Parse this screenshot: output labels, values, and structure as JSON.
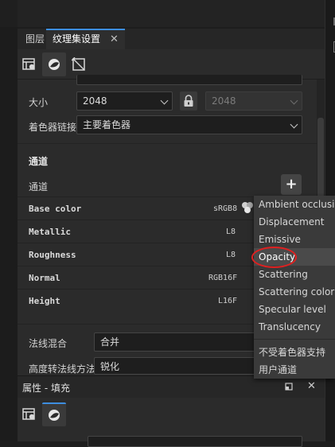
{
  "tabs": [
    {
      "label": "图层"
    },
    {
      "label": "纹理集设置",
      "close": "✕"
    }
  ],
  "settings": {
    "size_label": "大小",
    "size_value": "2048",
    "size_linked_value": "2048",
    "shader_link_label": "着色器链接",
    "shader_link_value": "主要着色器"
  },
  "channels": {
    "section_title": "通道",
    "channel_label": "通道",
    "add_button": "+",
    "rows": [
      {
        "name": "Base color",
        "format": "sRGB8"
      },
      {
        "name": "Metallic",
        "format": "L8"
      },
      {
        "name": "Roughness",
        "format": "L8"
      },
      {
        "name": "Normal",
        "format": "RGB16F"
      },
      {
        "name": "Height",
        "format": "L16F"
      }
    ]
  },
  "normal_settings": {
    "normal_mix_label": "法线混合",
    "normal_mix_value": "合并",
    "height_to_normal_label": "高度转法线方法",
    "height_to_normal_value": "锐化"
  },
  "properties_panel": {
    "title": "属性 - 填充",
    "dock_icon": "dock-icon",
    "close": "✕"
  },
  "dropdown": {
    "items": [
      "Ambient occlusion",
      "Displacement",
      "Emissive",
      "Opacity",
      "Scattering",
      "Scattering color",
      "Specular level",
      "Translucency"
    ],
    "extra_items": [
      "不受着色器支持",
      "用户通道"
    ],
    "highlighted": "Opacity"
  },
  "colors": {
    "accent": "#3d8ee0",
    "annotation": "#e02020"
  }
}
